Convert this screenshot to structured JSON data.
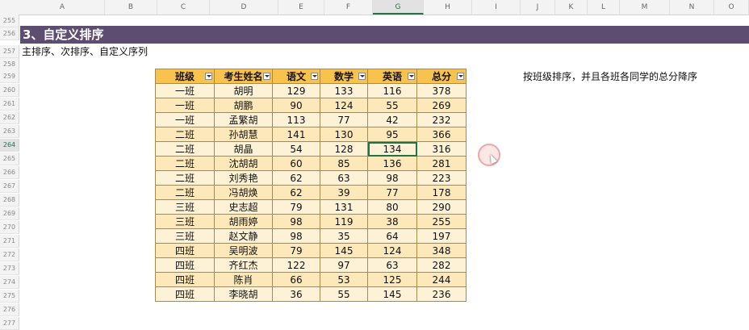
{
  "sheet": {
    "column_headers": [
      "A",
      "B",
      "C",
      "D",
      "E",
      "F",
      "G",
      "H",
      "I",
      "J",
      "K",
      "L",
      "M",
      "N",
      "O"
    ],
    "selected_column": "G",
    "row_numbers": [
      "255",
      "256",
      "257",
      "258",
      "259",
      "260",
      "261",
      "262",
      "263",
      "264",
      "265",
      "266",
      "267",
      "268",
      "269",
      "270",
      "271",
      "272",
      "273",
      "274",
      "275",
      "276",
      "277"
    ],
    "selected_row": "264",
    "section_title": "3、自定义排序",
    "subtitle": "主排序、次排序、自定义序列",
    "note": "按班级排序，并且各班各同学的总分降序",
    "table": {
      "headers": [
        "班级",
        "考生姓名",
        "语文",
        "数学",
        "英语",
        "总分"
      ],
      "rows": [
        [
          "一班",
          "胡明",
          "129",
          "133",
          "116",
          "378"
        ],
        [
          "一班",
          "胡鹏",
          "90",
          "124",
          "55",
          "269"
        ],
        [
          "一班",
          "孟繁胡",
          "113",
          "77",
          "42",
          "232"
        ],
        [
          "二班",
          "孙胡慧",
          "141",
          "130",
          "95",
          "366"
        ],
        [
          "二班",
          "胡晶",
          "54",
          "128",
          "134",
          "316"
        ],
        [
          "二班",
          "沈胡胡",
          "60",
          "85",
          "136",
          "281"
        ],
        [
          "二班",
          "刘秀艳",
          "62",
          "63",
          "98",
          "223"
        ],
        [
          "二班",
          "冯胡焕",
          "62",
          "39",
          "77",
          "178"
        ],
        [
          "三班",
          "史志超",
          "79",
          "131",
          "80",
          "290"
        ],
        [
          "三班",
          "胡雨婷",
          "98",
          "119",
          "38",
          "255"
        ],
        [
          "三班",
          "赵文静",
          "98",
          "35",
          "64",
          "197"
        ],
        [
          "四班",
          "吴明波",
          "79",
          "145",
          "124",
          "348"
        ],
        [
          "四班",
          "齐红杰",
          "122",
          "97",
          "63",
          "282"
        ],
        [
          "四班",
          "陈肖",
          "66",
          "53",
          "125",
          "244"
        ],
        [
          "四班",
          "李晓胡",
          "36",
          "55",
          "145",
          "236"
        ]
      ]
    }
  },
  "colors": {
    "banner": "#5d4d70",
    "table_header": "#f7c24d",
    "table_row": "#fdf1d6",
    "table_row_alt": "#fde8b9",
    "selection": "#217346"
  }
}
